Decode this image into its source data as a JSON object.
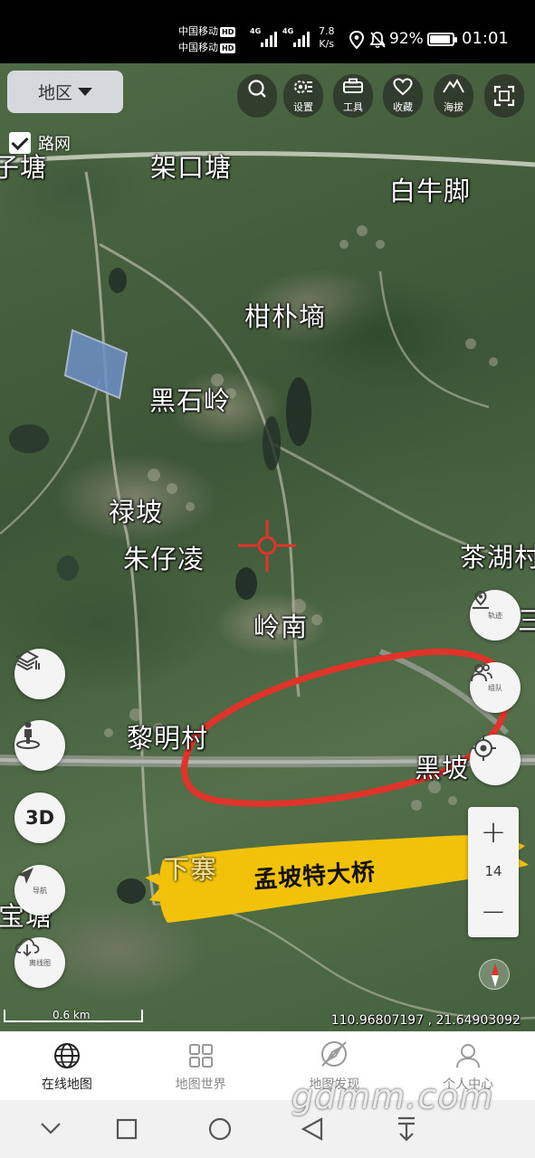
{
  "status_bar": {
    "carrier1": "中国移动",
    "carrier2": "中国移动",
    "hd": "HD",
    "net1": "4G",
    "net2": "4G",
    "speed_value": "7.8",
    "speed_unit": "K/s",
    "battery_percent": "92%",
    "battery_level": 0.92,
    "time": "01:01",
    "icons": [
      "location-icon",
      "mute-bell-icon",
      "battery-icon"
    ]
  },
  "map": {
    "region_button": "地区",
    "road_network_label": "路网",
    "road_network_checked": true,
    "toolbar": [
      {
        "name": "search",
        "label": "",
        "icon": "search-icon"
      },
      {
        "name": "settings",
        "label": "设置",
        "icon": "settings-icon"
      },
      {
        "name": "tools",
        "label": "工具",
        "icon": "toolbox-icon"
      },
      {
        "name": "favorites",
        "label": "收藏",
        "icon": "heart-icon"
      },
      {
        "name": "altitude",
        "label": "海拔",
        "icon": "mountain-icon"
      },
      {
        "name": "fullscreen",
        "label": "",
        "icon": "fullscreen-icon"
      }
    ],
    "places": [
      "子塘",
      "架口塘",
      "白牛脚",
      "柑朴墒",
      "黑石岭",
      "禄坡",
      "朱仔凌",
      "茶湖村",
      "岭南",
      "黎明村",
      "黑坡",
      "下寨",
      "宝塘",
      "三"
    ],
    "annotation_banner": "孟坡特大桥",
    "left_controls": [
      {
        "name": "layers",
        "label": "",
        "icon": "layers-icon"
      },
      {
        "name": "street-view",
        "label": "",
        "icon": "person-pin-icon"
      },
      {
        "name": "3d",
        "label": "3D",
        "icon": ""
      },
      {
        "name": "navigation",
        "label": "导航",
        "icon": "navigation-arrow-icon"
      },
      {
        "name": "offline",
        "label": "离线图",
        "icon": "cloud-download-icon"
      }
    ],
    "right_controls": [
      {
        "name": "track",
        "label": "轨迹",
        "icon": "track-pin-icon"
      },
      {
        "name": "team",
        "label": "组队",
        "icon": "team-icon"
      },
      {
        "name": "locate",
        "label": "",
        "icon": "locate-crosshair-icon"
      }
    ],
    "zoom_in": "+",
    "zoom_level": "14",
    "zoom_out": "−",
    "scale_label": "0.6 km",
    "coordinates": "110.96807197 , 21.64903092"
  },
  "bottom_nav": [
    {
      "label": "在线地图",
      "icon": "globe-icon",
      "active": true
    },
    {
      "label": "地图世界",
      "icon": "grid-icon",
      "active": false
    },
    {
      "label": "地图发现",
      "icon": "compass-discover-icon",
      "active": false
    },
    {
      "label": "个人中心",
      "icon": "user-icon",
      "active": false
    }
  ],
  "watermark": "gdmm.com",
  "colors": {
    "annotation_red": "#e0332a",
    "banner_yellow": "#f2c20a",
    "crosshair_red": "#e0332a"
  }
}
